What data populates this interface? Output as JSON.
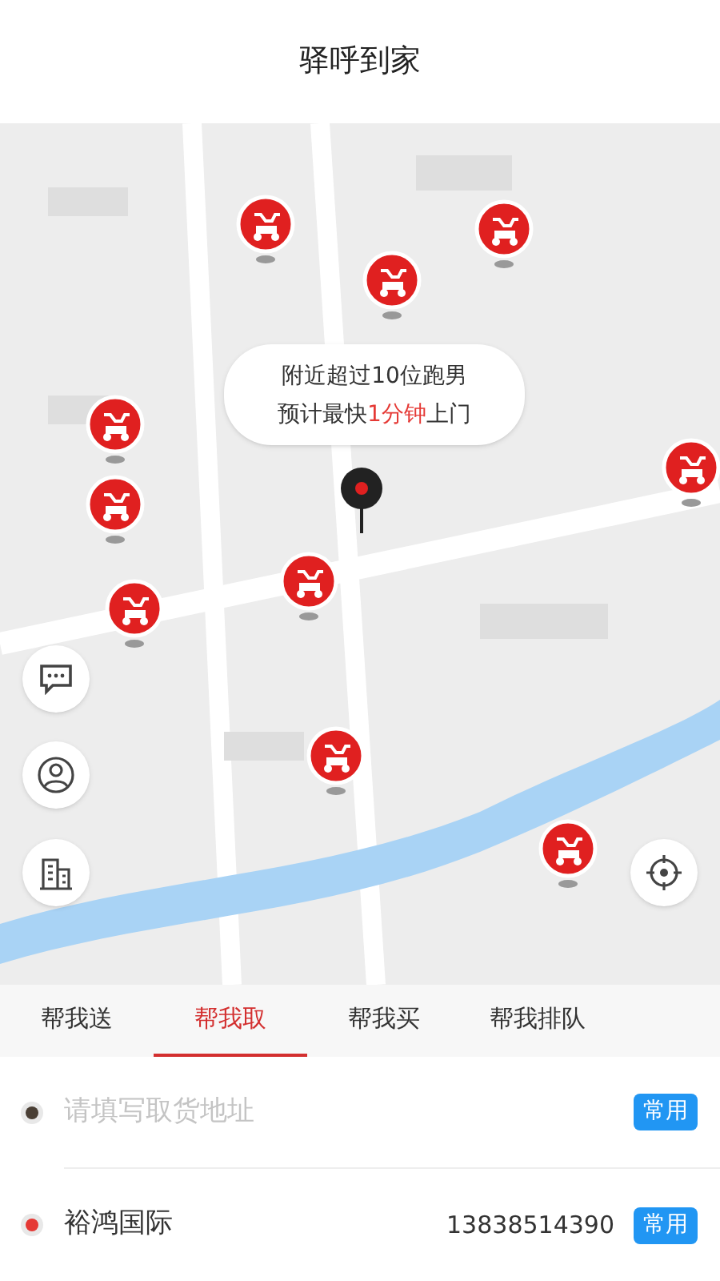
{
  "title": "驿呼到家",
  "bubble": {
    "line_1": "附近超过10位跑男",
    "line_2_prefix": "预计最快",
    "line_2_highlight": "1分钟",
    "line_2_suffix": "上门"
  },
  "tabs": [
    {
      "label": "帮我送",
      "selected": false
    },
    {
      "label": "帮我取",
      "selected": true
    },
    {
      "label": "帮我买",
      "selected": false
    },
    {
      "label": "帮我排队",
      "selected": false
    }
  ],
  "addresses": [
    {
      "kind": "empty",
      "color": "#4a3f35",
      "placeholder": "请填写取货地址",
      "button": "常用"
    },
    {
      "kind": "filled",
      "color": "#e53935",
      "value": "裕鸿国际",
      "phone": "13838514390",
      "button": "常用"
    }
  ]
}
